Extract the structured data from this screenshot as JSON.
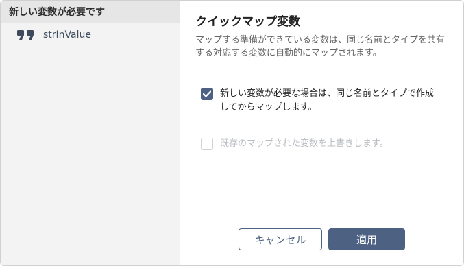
{
  "left_panel": {
    "header": "新しい変数が必要です",
    "items": [
      {
        "icon": "quote-icon",
        "label": "strInValue"
      }
    ]
  },
  "main": {
    "title": "クイックマップ変数",
    "description": "マップする準備ができている変数は、同じ名前とタイプを共有する対応する変数に自動的にマップされます。",
    "options": [
      {
        "label": "新しい変数が必要な場合は、同じ名前とタイプで作成してからマップします。",
        "checked": true,
        "enabled": true
      },
      {
        "label": "既存のマップされた変数を上書きします。",
        "checked": false,
        "enabled": false
      }
    ]
  },
  "buttons": {
    "cancel": "キャンセル",
    "apply": "適用"
  },
  "colors": {
    "accent": "#4d6282",
    "left_bg": "#f3f3f3",
    "left_header_bg": "#e6e6e6"
  }
}
